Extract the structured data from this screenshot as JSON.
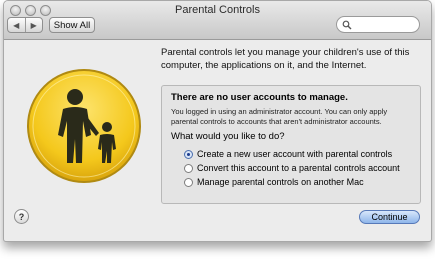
{
  "window": {
    "title": "Parental Controls"
  },
  "toolbar": {
    "back_glyph": "◀",
    "forward_glyph": "▶",
    "show_all_label": "Show All",
    "search_placeholder": ""
  },
  "main": {
    "icon": "parent-and-child-icon",
    "intro_text": "Parental controls let you manage your children's use of this computer, the applications on it, and the Internet.",
    "box": {
      "heading": "There are no user accounts to manage.",
      "detail": "You logged in using an administrator account. You can only apply parental controls to accounts that aren't administrator accounts.",
      "question": "What would you like to do?",
      "options": [
        {
          "label": "Create a new user account with parental controls",
          "selected": true
        },
        {
          "label": "Convert this account to a parental controls account",
          "selected": false
        },
        {
          "label": "Manage parental controls on another Mac",
          "selected": false
        }
      ]
    }
  },
  "footer": {
    "help_label": "?",
    "continue_label": "Continue"
  },
  "colors": {
    "icon_yellow": "#f4c81c",
    "default_button": "#8fb6ea"
  }
}
